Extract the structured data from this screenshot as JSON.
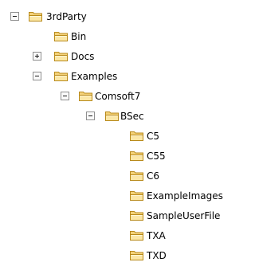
{
  "tree": {
    "nodes": [
      {
        "label": "3rdParty",
        "icon": "folder-icon",
        "toggle": "collapse",
        "name": "3rdparty"
      },
      {
        "label": "Bin",
        "icon": "folder-icon",
        "toggle": "none",
        "name": "bin"
      },
      {
        "label": "Docs",
        "icon": "folder-icon",
        "toggle": "expand",
        "name": "docs"
      },
      {
        "label": "Examples",
        "icon": "folder-icon",
        "toggle": "collapse",
        "name": "examples"
      },
      {
        "label": "Comsoft7",
        "icon": "folder-icon",
        "toggle": "collapse",
        "name": "comsoft7"
      },
      {
        "label": "BSec",
        "icon": "folder-icon",
        "toggle": "collapse",
        "name": "bsec"
      },
      {
        "label": "C5",
        "icon": "folder-icon",
        "toggle": "none",
        "name": "c5"
      },
      {
        "label": "C55",
        "icon": "folder-icon",
        "toggle": "none",
        "name": "c55"
      },
      {
        "label": "C6",
        "icon": "folder-icon",
        "toggle": "none",
        "name": "c6"
      },
      {
        "label": "ExampleImages",
        "icon": "folder-icon",
        "toggle": "none",
        "name": "exampleimages"
      },
      {
        "label": "SampleUserFile",
        "icon": "folder-icon",
        "toggle": "none",
        "name": "sampleuserfile"
      },
      {
        "label": "TXA",
        "icon": "folder-icon",
        "toggle": "none",
        "name": "txa"
      },
      {
        "label": "TXD",
        "icon": "folder-icon",
        "toggle": "none",
        "name": "txd"
      }
    ]
  },
  "colors": {
    "folder_fill": "#f4d27a",
    "folder_fill_light": "#fbe7a6",
    "folder_outline": "#b88a1b",
    "toggle_border": "#8f8f8f"
  }
}
